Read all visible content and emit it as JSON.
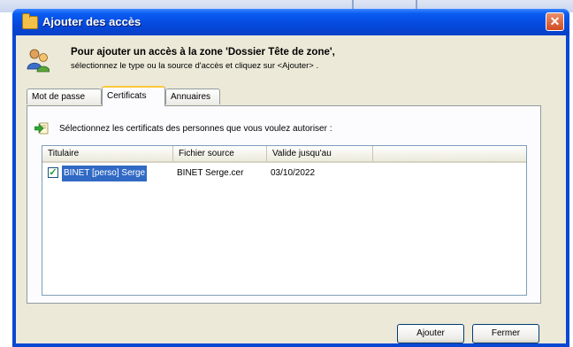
{
  "window": {
    "title": "Ajouter des accès",
    "close_glyph": "✕"
  },
  "header": {
    "line1": "Pour ajouter un accès à la zone 'Dossier Tête de zone',",
    "line2": "sélectionnez le type ou la source d'accès et cliquez sur <Ajouter> ."
  },
  "tabs": [
    {
      "label": "Mot de passe",
      "active": false
    },
    {
      "label": "Certificats",
      "active": true
    },
    {
      "label": "Annuaires",
      "active": false
    }
  ],
  "certificats": {
    "instruction": "Sélectionnez les certificats des personnes que vous voulez autoriser :",
    "columns": [
      "Titulaire",
      "Fichier source",
      "Valide jusqu'au"
    ],
    "rows": [
      {
        "checked": true,
        "titulaire": "BINET [perso] Serge",
        "fichier": "BINET Serge.cer",
        "valide": "03/10/2022"
      }
    ]
  },
  "buttons": {
    "add": "Ajouter",
    "close": "Fermer"
  },
  "colors": {
    "titlebar": "#0549dc",
    "client": "#ece9d8",
    "selection": "#316ac5",
    "check": "#21a121"
  },
  "icons": {
    "title": "folder-icon",
    "header": "users-icon",
    "instruction": "arrow-certificate-icon",
    "close": "close-icon"
  }
}
